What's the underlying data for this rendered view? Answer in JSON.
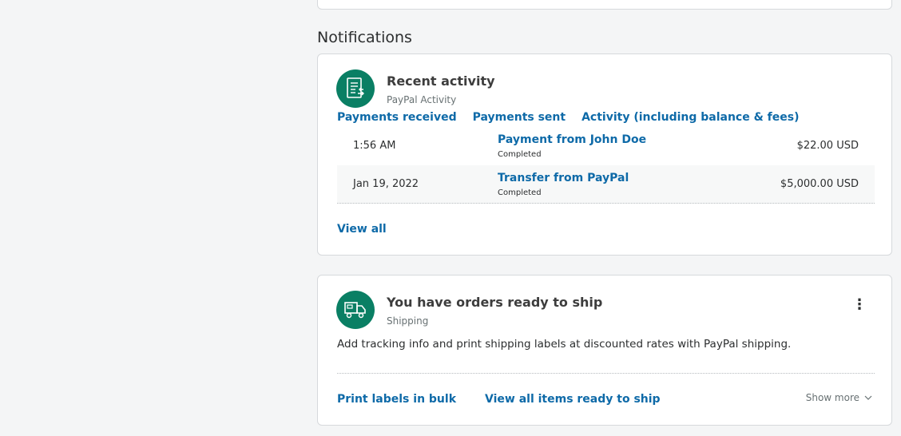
{
  "notifications": {
    "section_title": "Notifications"
  },
  "activity_card": {
    "icon": "activity-list-icon",
    "title": "Recent activity",
    "subtitle": "PayPal Activity",
    "filters": [
      {
        "label": "Payments received"
      },
      {
        "label": "Payments sent"
      },
      {
        "label": "Activity (including balance & fees)"
      }
    ],
    "transactions": [
      {
        "date": "1:56 AM",
        "title": "Payment from John Doe",
        "status": "Completed",
        "amount": "$22.00 USD"
      },
      {
        "date": "Jan 19, 2022",
        "title": "Transfer from PayPal",
        "status": "Completed",
        "amount": "$5,000.00 USD"
      }
    ],
    "view_all_label": "View all"
  },
  "shipping_card": {
    "icon": "shipping-truck-icon",
    "title": "You have orders ready to ship",
    "subtitle": "Shipping",
    "menu_icon": "more-vertical-icon",
    "description": "Add tracking info and print shipping labels at discounted rates with PayPal shipping.",
    "actions": [
      {
        "label": "Print labels in bulk"
      },
      {
        "label": "View all items ready to ship"
      }
    ],
    "show_more_label": "Show more"
  },
  "colors": {
    "accent_green": "#0a7f64",
    "link_blue": "#0e6aa8"
  }
}
